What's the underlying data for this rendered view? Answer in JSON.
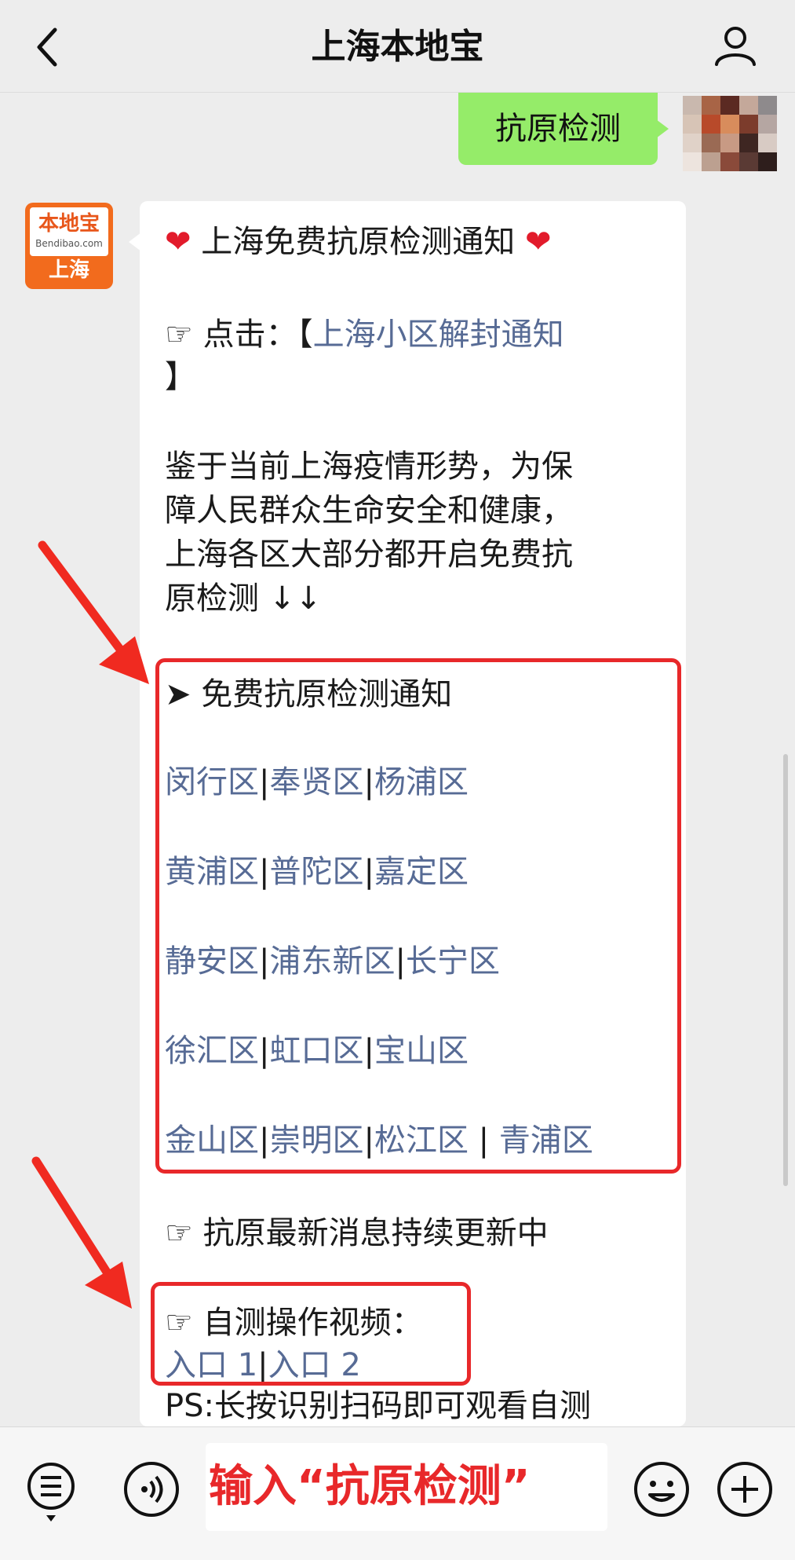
{
  "header": {
    "title": "上海本地宝"
  },
  "sent": {
    "text": "抗原检测"
  },
  "bot_avatar": {
    "logo": "本地宝",
    "logo_sub": "Bendibao.com",
    "city": "上海"
  },
  "message": {
    "title_line": "❤️ 上海免费抗原检测通知 ❤️",
    "title_text": "上海免费抗原检测通知",
    "heart": "❤",
    "click_prefix": "☞ 点击：【",
    "click_link": "上海小区解封通知",
    "click_suffix": "】",
    "para1_line1": "鉴于当前上海疫情形势，为保",
    "para1_line2": "障人民群众生命安全和健康，",
    "para1_line3": "上海各区大部分都开启免费抗",
    "para1_line4": "原检测 ↓↓",
    "section_title": "➤ 免费抗原检测通知",
    "districts": [
      [
        "闵行区",
        "奉贤区",
        "杨浦区"
      ],
      [
        "黄浦区",
        "普陀区",
        "嘉定区"
      ],
      [
        "静安区",
        "浦东新区",
        "长宁区"
      ],
      [
        "徐汇区",
        "虹口区",
        "宝山区"
      ],
      [
        "金山区",
        "崇明区",
        "松江区",
        "青浦区"
      ]
    ],
    "update_line": "☞ 抗原最新消息持续更新中",
    "video_line": "☞ 自测操作视频：",
    "entry1": "入口 1",
    "entry2": "入口 2",
    "ps_line": "PS:长按识别扫码即可观看自测"
  },
  "input": {
    "text": "输入“抗原检测”"
  },
  "colors": {
    "link": "#576b95",
    "highlight": "#e8282a",
    "sent_bubble": "#95ec69"
  }
}
